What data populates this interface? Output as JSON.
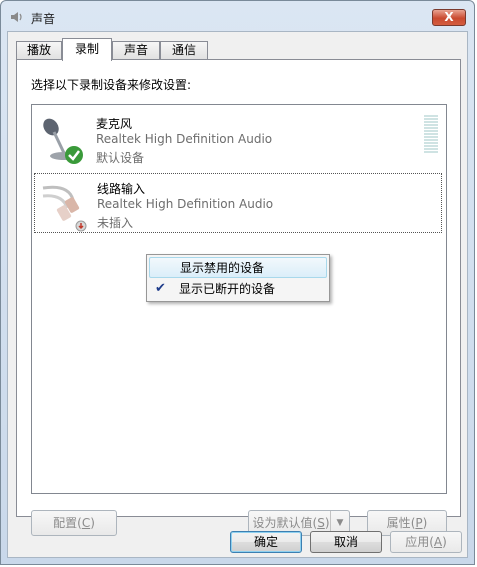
{
  "window": {
    "title": "声音",
    "close_label": "X"
  },
  "tabs": [
    {
      "label": "播放"
    },
    {
      "label": "录制"
    },
    {
      "label": "声音"
    },
    {
      "label": "通信"
    }
  ],
  "panel": {
    "prompt": "选择以下录制设备来修改设置:"
  },
  "devices": [
    {
      "name": "麦克风",
      "driver": "Realtek High Definition Audio",
      "status": "默认设备"
    },
    {
      "name": "线路输入",
      "driver": "Realtek High Definition Audio",
      "status": "未插入"
    }
  ],
  "context_menu": {
    "items": [
      {
        "label": "显示禁用的设备",
        "checked": false
      },
      {
        "label": "显示已断开的设备",
        "checked": true
      }
    ],
    "check_glyph": "✔"
  },
  "panel_buttons": {
    "configure": {
      "text": "配置",
      "key": "C"
    },
    "set_default": {
      "text": "设为默认值",
      "key": "S",
      "arrow": "▼"
    },
    "properties": {
      "text": "属性",
      "key": "P"
    }
  },
  "dialog_buttons": {
    "ok": "确定",
    "cancel": "取消",
    "apply": {
      "text": "应用",
      "key": "A"
    }
  }
}
